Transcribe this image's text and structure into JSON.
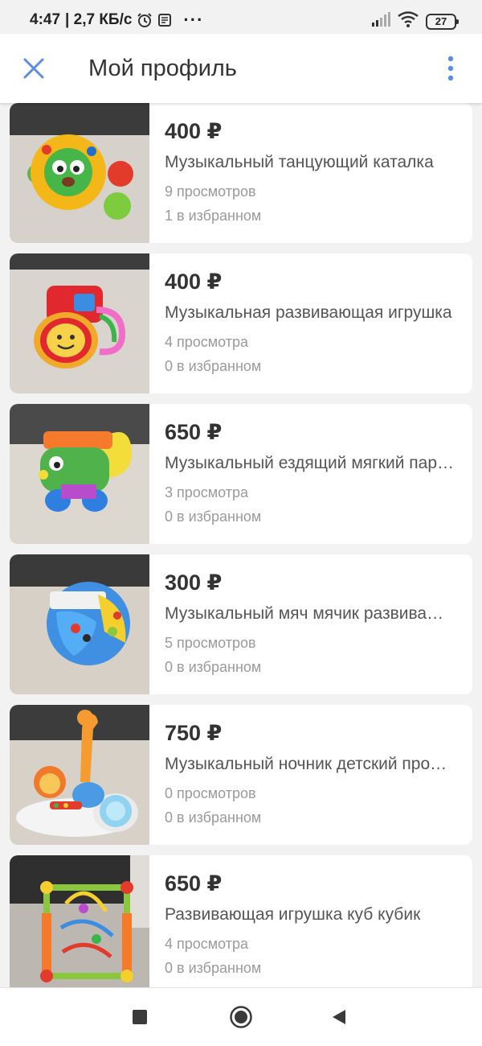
{
  "status_bar": {
    "time": "4:47",
    "speed": "| 2,7 КБ/с",
    "more": "···",
    "battery": "27",
    "icons": [
      "alarm-icon",
      "notification-icon",
      "signal-icon",
      "wifi-icon",
      "battery-icon"
    ]
  },
  "app_bar": {
    "title": "Мой профиль",
    "close_icon": "close-icon",
    "menu_icon": "more-vertical-icon"
  },
  "colors": {
    "accent": "#5b8de3",
    "background": "#f2f2f2",
    "card": "#ffffff"
  },
  "listings": [
    {
      "price": "400 ₽",
      "title": "Музыкальный танцующий каталка",
      "views": "9 просмотров",
      "favorites": "1 в избранном",
      "image": "toy-ball-photo"
    },
    {
      "price": "400 ₽",
      "title": "Музыкальная развивающая игрушка",
      "views": "4 просмотра",
      "favorites": "0 в избранном",
      "image": "toy-drum-photo"
    },
    {
      "price": "650 ₽",
      "title": "Музыкальный ездящий мягкий паровоз",
      "views": "3 просмотра",
      "favorites": "0 в избранном",
      "image": "toy-car-photo"
    },
    {
      "price": "300 ₽",
      "title": "Музыкальный мяч мячик развивающий",
      "views": "5 просмотров",
      "favorites": "0 в избранном",
      "image": "toy-ball-blue-photo"
    },
    {
      "price": "750 ₽",
      "title": "Музыкальный ночник детский проектор",
      "views": "0 просмотров",
      "favorites": "0 в избранном",
      "image": "toy-nightlight-photo"
    },
    {
      "price": "650 ₽",
      "title": "Развивающая игрушка куб кубик",
      "views": "4 просмотра",
      "favorites": "0 в избранном",
      "image": "toy-cube-photo"
    }
  ],
  "nav_bar": {
    "icons": [
      "recents-square-icon",
      "home-circle-icon",
      "back-triangle-icon"
    ]
  }
}
